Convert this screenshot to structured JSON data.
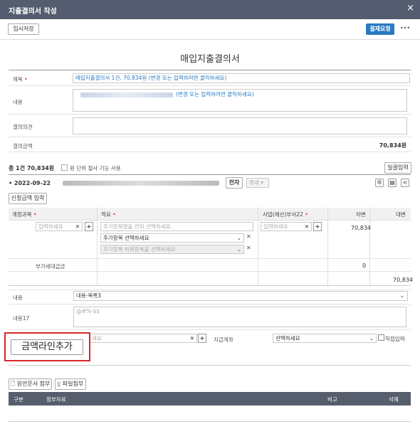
{
  "window": {
    "title": "지출결의서 작성",
    "close": "×"
  },
  "toolbar": {
    "temp_save": "임시저장",
    "approve": "결재요청",
    "more": "•••"
  },
  "doc_title": "매입지출결의서",
  "form": {
    "title_label": "제목",
    "title_value": "매입지출결의서 1건, 70,834원 (변경 또는 입력하려면 클릭하세요)",
    "content_label": "내용",
    "content_value": "(변경 또는 입력하려면 클릭하세요)",
    "opinion_label": "결의의견",
    "amount_label": "결의금액",
    "amount_value": "70,834원"
  },
  "summary": {
    "total": "총 1건 70,834원",
    "won_unit": "원 단위 절사 기능 사용",
    "bulk_input": "일괄입력"
  },
  "entry": {
    "date": "• 2022-09-22",
    "esign": "전자",
    "dropdown": "명세",
    "amount_input": "신청금액 입력"
  },
  "table": {
    "headers": {
      "account": "계정과목",
      "summary": "적요",
      "dept": "사업(예산)부서22",
      "debit": "차변",
      "credit": "대변"
    },
    "account_placeholder": "입력하세요",
    "summary_placeholder": "추가항목명을 먼저 선택하세요.",
    "add_item_select": "추가항목 선택하세요",
    "add_item_select2": "추가항목 하위항목을 선택하세요",
    "dept_placeholder": "입력하세요",
    "debit_value": "70,834",
    "vat_label": "부가세대급금",
    "vat_value": "0",
    "credit_total": "70,834"
  },
  "detail": {
    "content_label": "내용",
    "content_select": "내용-목록3",
    "content17_label": "내용17",
    "content17_placeholder": "@#%-$$",
    "add_line": "금액라인추가",
    "mid_placeholder": "세요",
    "account_label": "지급계좌",
    "account_select": "선택하세요",
    "direct_input": "직접입력"
  },
  "attach": {
    "draft_attach": "원안문서 첨부",
    "file_attach": "파일첨부"
  },
  "attach_table": {
    "col1": "구분",
    "col2": "첨부자료",
    "col3": "비고",
    "col4": "삭제"
  }
}
